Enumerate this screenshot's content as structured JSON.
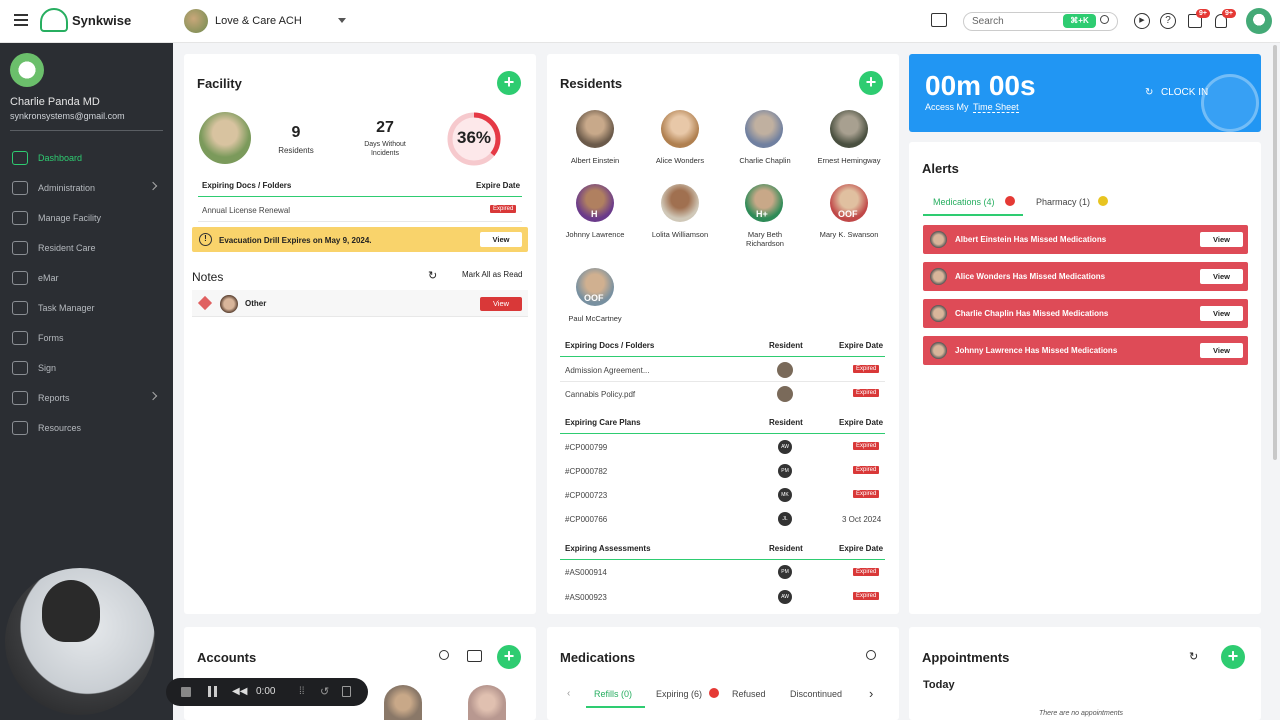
{
  "app": {
    "name": "Synkwise",
    "facility": "Love & Care ACH",
    "search_placeholder": "Search",
    "search_shortcut": "⌘+K",
    "badge_1": "9+",
    "badge_2": "9+",
    "accent": "#2ecc71"
  },
  "sidebar": {
    "user_name": "Charlie Panda MD",
    "user_email": "synkronsystems@gmail.com",
    "items": [
      {
        "label": "Dashboard"
      },
      {
        "label": "Administration"
      },
      {
        "label": "Manage Facility"
      },
      {
        "label": "Resident Care"
      },
      {
        "label": "eMar"
      },
      {
        "label": "Task Manager"
      },
      {
        "label": "Forms"
      },
      {
        "label": "Sign"
      },
      {
        "label": "Reports"
      },
      {
        "label": "Resources"
      }
    ]
  },
  "facility": {
    "title": "Facility",
    "residents_count": "9",
    "residents_label": "Residents",
    "days_count": "27",
    "days_label_1": "Days Without",
    "days_label_2": "Incidents",
    "percent": "36%",
    "percent_value": 0.36,
    "docs_header": "Expiring Docs / Folders",
    "expire_header": "Expire Date",
    "doc_row": "Annual License Renewal",
    "doc_status": "Expired",
    "drill_text": "Evacuation Drill Expires on May 9, 2024.",
    "drill_btn": "View"
  },
  "notes": {
    "title": "Notes",
    "mark_all": "Mark All as Read",
    "item": "Other",
    "btn": "View"
  },
  "residents": {
    "title": "Residents",
    "people": [
      {
        "name": "Albert Einstein",
        "tag": ""
      },
      {
        "name": "Alice Wonders",
        "tag": ""
      },
      {
        "name": "Charlie Chaplin",
        "tag": ""
      },
      {
        "name": "Ernest Hemingway",
        "tag": ""
      },
      {
        "name": "Johnny Lawrence",
        "tag": "H"
      },
      {
        "name": "Lolita Williamson",
        "tag": ""
      },
      {
        "name": "Mary Beth",
        "name2": "Richardson",
        "tag": "H+"
      },
      {
        "name": "Mary K. Swanson",
        "tag": "OOF"
      },
      {
        "name": "Paul McCartney",
        "tag": "OOF"
      }
    ],
    "docs_header": "Expiring Docs / Folders",
    "resident_header": "Resident",
    "expire_header": "Expire Date",
    "docs": [
      {
        "name": "Admission Agreement...",
        "status": "Expired"
      },
      {
        "name": "Cannabis Policy.pdf",
        "status": "Expired"
      }
    ],
    "care_header": "Expiring Care Plans",
    "care": [
      {
        "id": "#CP000799",
        "init": "AW",
        "status": "Expired"
      },
      {
        "id": "#CP000782",
        "init": "PM",
        "status": "Expired"
      },
      {
        "id": "#CP000723",
        "init": "MK",
        "status": "Expired"
      },
      {
        "id": "#CP000766",
        "init": "JL",
        "status": "3 Oct 2024"
      }
    ],
    "assess_header": "Expiring Assessments",
    "assess": [
      {
        "id": "#AS000914",
        "init": "PM",
        "status": "Expired"
      },
      {
        "id": "#AS000923",
        "init": "AW",
        "status": "Expired"
      }
    ]
  },
  "clock": {
    "time": "00m 00s",
    "sub_1": "Access My",
    "sub_2": "Time Sheet",
    "btn": "CLOCK IN"
  },
  "alerts": {
    "title": "Alerts",
    "tab_meds": "Medications (4)",
    "tab_pharm": "Pharmacy (1)",
    "rows": [
      {
        "text": "Albert Einstein Has Missed Medications",
        "btn": "View"
      },
      {
        "text": "Alice Wonders Has Missed Medications",
        "btn": "View"
      },
      {
        "text": "Charlie Chaplin Has Missed Medications",
        "btn": "View"
      },
      {
        "text": "Johnny Lawrence Has Missed Medications",
        "btn": "View"
      }
    ]
  },
  "accounts": {
    "title": "Accounts"
  },
  "medications": {
    "title": "Medications",
    "tabs": [
      "Refills (0)",
      "Expiring (6)",
      "Refused",
      "Discontinued"
    ]
  },
  "appointments": {
    "title": "Appointments",
    "today": "Today",
    "empty": "There are no appointments"
  },
  "recorder": {
    "time": "0:00"
  }
}
